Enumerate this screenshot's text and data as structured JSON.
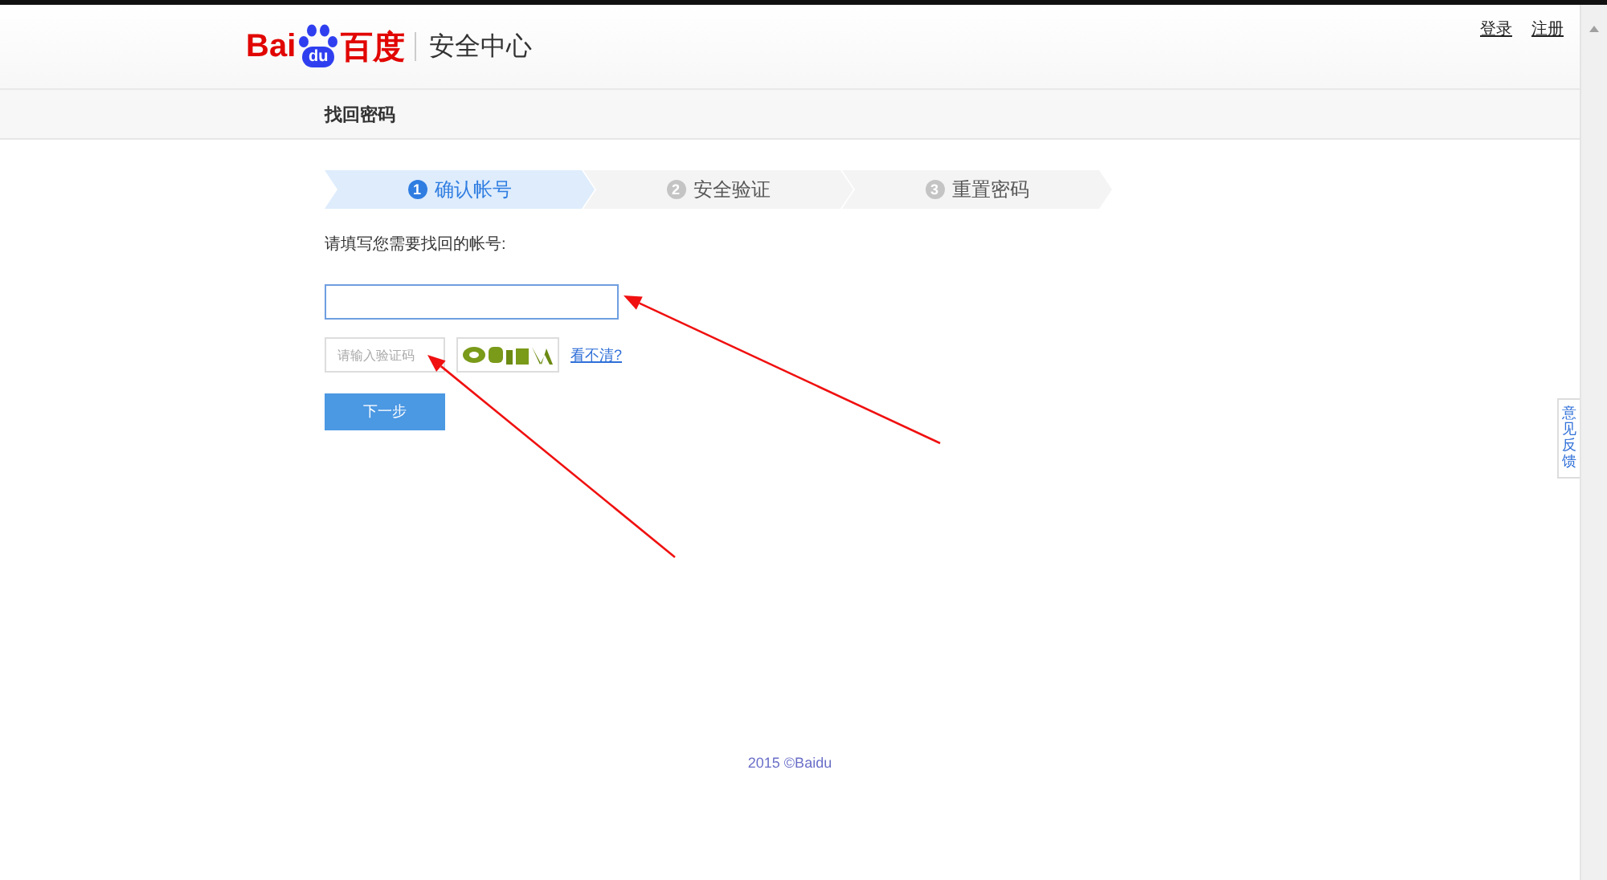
{
  "header": {
    "logo": {
      "left": "Bai",
      "paw": "du",
      "right": "百度"
    },
    "title": "安全中心",
    "links": [
      {
        "label": "登录"
      },
      {
        "label": "注册"
      }
    ]
  },
  "subheader": {
    "title": "找回密码"
  },
  "steps": [
    {
      "number": "1",
      "label": "确认帐号",
      "selected": true
    },
    {
      "number": "2",
      "label": "安全验证",
      "selected": false
    },
    {
      "number": "3",
      "label": "重置密码",
      "selected": false
    }
  ],
  "form": {
    "prompt": "请填写您需要找回的帐号:",
    "account_field": {
      "focused": true
    },
    "captcha_field": {
      "placeholder": "请输入验证码"
    },
    "refresh_link": "看不清?",
    "submit": "下一步"
  },
  "feedback_tab": "意见反馈",
  "footer": "2015 ©Baidu",
  "annotations": [
    {
      "kind": "arrow"
    },
    {
      "kind": "arrow"
    }
  ]
}
